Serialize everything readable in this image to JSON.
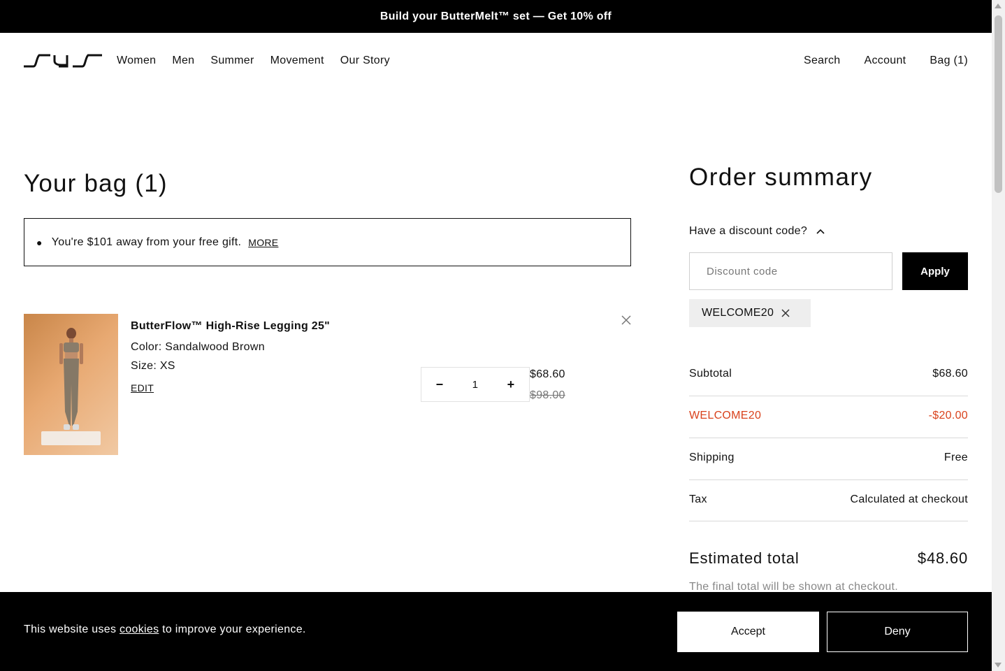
{
  "promo_banner": {
    "text": "Build your ButterMelt™ set — Get 10% off"
  },
  "header": {
    "logo_icon": "brand-logo-icon",
    "nav": [
      "Women",
      "Men",
      "Summer",
      "Movement",
      "Our Story"
    ],
    "utility": {
      "search": "Search",
      "account": "Account",
      "bag": "Bag (1)"
    }
  },
  "bag": {
    "title": "Your bag (1)",
    "gift_message": "You're $101 away from your free gift.",
    "gift_more": "MORE",
    "items": [
      {
        "name": "ButterFlow™ High-Rise Legging 25\"",
        "color": "Color: Sandalwood Brown",
        "size": "Size: XS",
        "edit_label": "EDIT",
        "quantity": "1",
        "price": "$68.60",
        "original_price": "$98.00",
        "remove_icon": "close-icon",
        "decrement_icon": "minus-icon",
        "increment_icon": "plus-icon"
      }
    ]
  },
  "order_summary": {
    "title": "Order summary",
    "discount_toggle": "Have a discount code?",
    "discount_placeholder": "Discount code",
    "apply_label": "Apply",
    "applied_code": "WELCOME20",
    "rows": {
      "subtotal_label": "Subtotal",
      "subtotal_value": "$68.60",
      "discount_label": "WELCOME20",
      "discount_value": "-$20.00",
      "shipping_label": "Shipping",
      "shipping_value": "Free",
      "tax_label": "Tax",
      "tax_value": "Calculated at checkout"
    },
    "estimated_total_label": "Estimated total",
    "estimated_total_value": "$48.60",
    "final_note": "The final total will be shown at checkout."
  },
  "cookie_banner": {
    "text_before": "This website uses ",
    "link": "cookies",
    "text_after": " to improve your experience.",
    "accept_label": "Accept",
    "deny_label": "Deny"
  },
  "colors": {
    "accent_discount": "#d9421c",
    "primary_button": "#000000",
    "chip_background": "#eeeeee"
  }
}
